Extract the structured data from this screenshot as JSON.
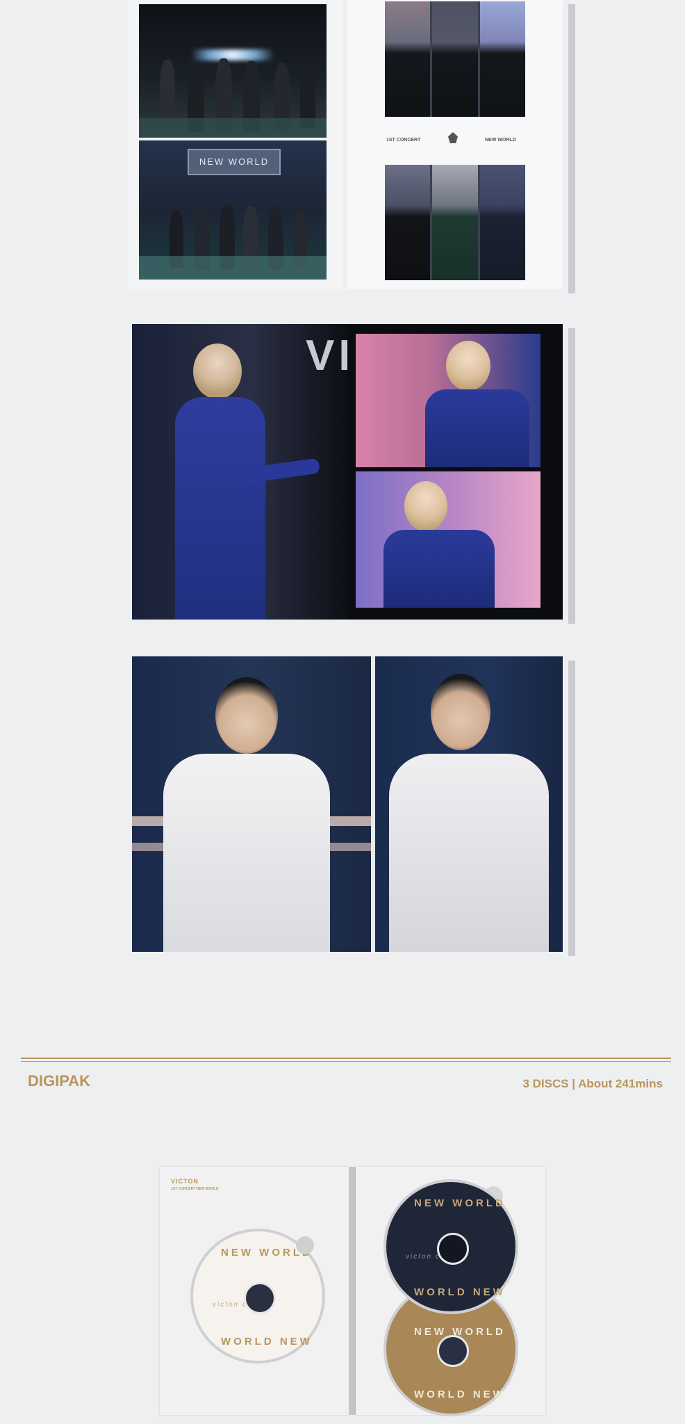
{
  "spread1": {
    "banner_text": "NEW WORLD",
    "caption_left": "1ST CONCERT",
    "caption_right": "NEW WORLD"
  },
  "spread2": {
    "wall_letters": "VI"
  },
  "section": {
    "title": "DIGIPAK",
    "info": "3 DISCS | About 241mins"
  },
  "digipak": {
    "brand": "VICTON",
    "subtitle": "1ST CONCERT NEW WORLD",
    "disc_top_word": "NEW WORLD",
    "disc_bottom_word": "WORLD NEW",
    "disc_script": "victon concert"
  },
  "colors": {
    "accent_gold": "#b8965a",
    "navy_disc": "#1f2638",
    "brown_disc": "#a98757"
  }
}
